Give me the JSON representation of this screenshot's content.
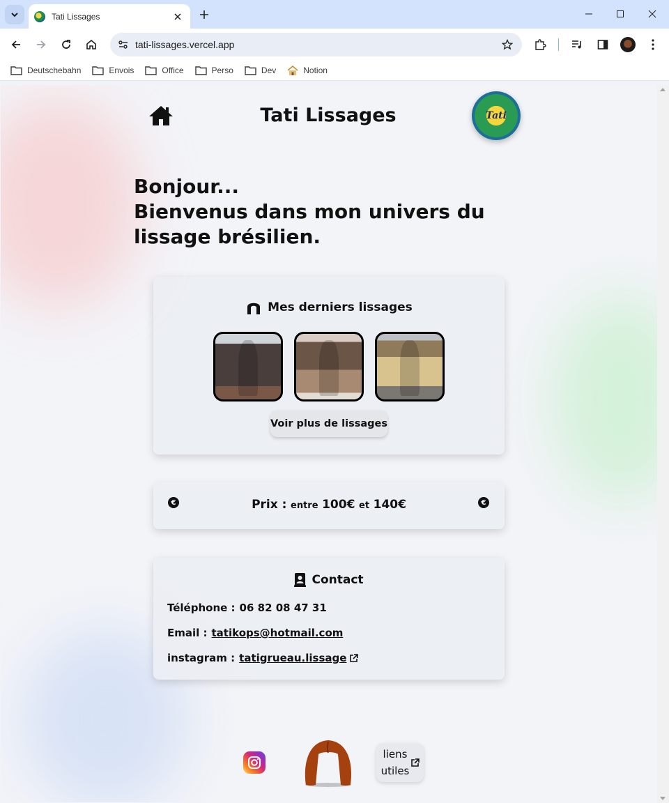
{
  "browser": {
    "tab_title": "Tati Lissages",
    "url": "tati-lissages.vercel.app",
    "bookmarks": [
      {
        "label": "Deutschebahn",
        "icon": "folder-icon"
      },
      {
        "label": "Envois",
        "icon": "folder-icon"
      },
      {
        "label": "Office",
        "icon": "folder-icon"
      },
      {
        "label": "Perso",
        "icon": "folder-icon"
      },
      {
        "label": "Dev",
        "icon": "folder-icon"
      },
      {
        "label": "Notion",
        "icon": "notion-home-icon"
      }
    ]
  },
  "header": {
    "title": "Tati Lissages",
    "logo_text": "Tati"
  },
  "greeting": {
    "line1": "Bonjour...",
    "line2": "Bienvenus dans mon univers du lissage brésilien."
  },
  "gallery": {
    "title": "Mes derniers lissages",
    "more_button": "Voir plus de lissages",
    "thumbnails": [
      "lissage-1",
      "lissage-2",
      "lissage-3"
    ]
  },
  "price": {
    "label": "Prix :",
    "between": "entre",
    "min": "100€",
    "and": "et",
    "max": "140€",
    "currency_badge": "€"
  },
  "contact": {
    "title": "Contact",
    "phone_label": "Téléphone :",
    "phone": "06 82 08 47 31",
    "email_label": "Email :",
    "email": "tatikops@hotmail.com",
    "instagram_label": "instagram :",
    "instagram": "tatigrueau.lissage"
  },
  "footer": {
    "links_button": "liens utiles"
  },
  "colors": {
    "tabbar": "#d3e3fd",
    "page_bg": "#f3f4f8",
    "card_bg": "#eceef3",
    "wig": "#a5400f"
  }
}
